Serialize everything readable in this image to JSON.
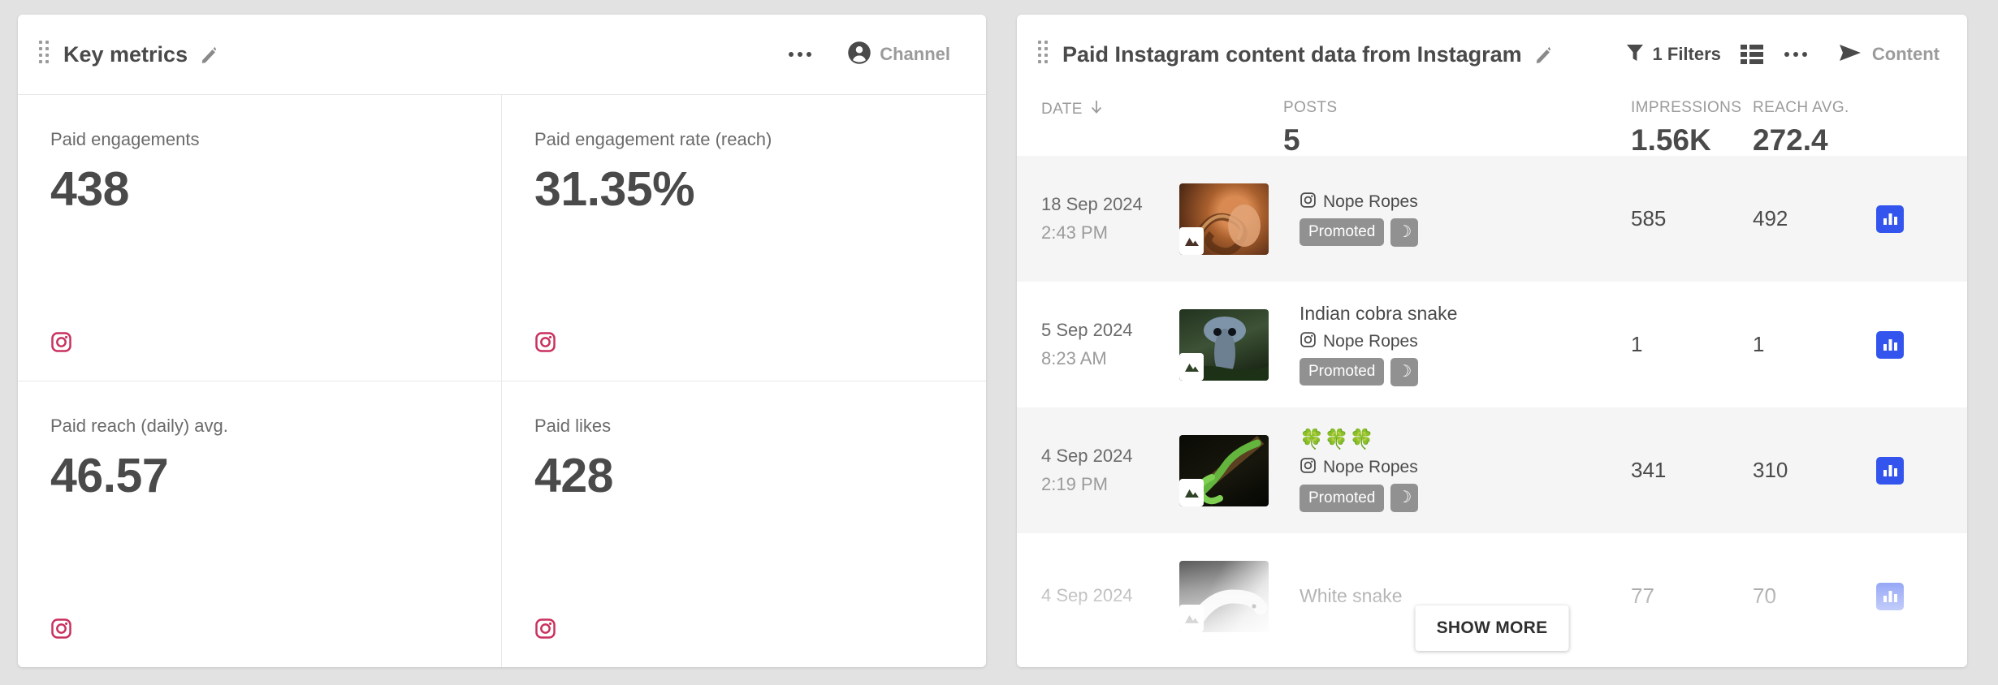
{
  "widgets": {
    "key_metrics": {
      "title": "Key metrics",
      "edit_icon": "pencil-icon",
      "more_icon": "ellipsis-icon",
      "channel_label": "Channel",
      "channel_icon": "person-icon",
      "drag_icon": "drag-handle-icon",
      "metrics": [
        {
          "label": "Paid engagements",
          "value": "438",
          "network_icon": "instagram-icon"
        },
        {
          "label": "Paid engagement rate (reach)",
          "value": "31.35%",
          "network_icon": "instagram-icon"
        },
        {
          "label": "Paid reach (daily) avg.",
          "value": "46.57",
          "network_icon": "instagram-icon"
        },
        {
          "label": "Paid likes",
          "value": "428",
          "network_icon": "instagram-icon"
        }
      ]
    },
    "content_table": {
      "title": "Paid Instagram content data from Instagram",
      "edit_icon": "pencil-icon",
      "drag_icon": "drag-handle-icon",
      "filters_label": "1 Filters",
      "filters_icon": "funnel-icon",
      "list_view_icon": "list-view-icon",
      "more_icon": "ellipsis-icon",
      "content_label": "Content",
      "content_icon": "send-icon",
      "show_more_label": "SHOW MORE",
      "columns": [
        {
          "key": "date",
          "label": "DATE",
          "sort_icon": "arrow-down-icon",
          "summary": ""
        },
        {
          "key": "posts",
          "label": "POSTS",
          "summary": "5"
        },
        {
          "key": "impressions",
          "label": "IMPRESSIONS",
          "summary": "1.56K"
        },
        {
          "key": "reach_avg",
          "label": "REACH AVG.",
          "summary": "272.4"
        }
      ],
      "rows": [
        {
          "date": "18 Sep 2024",
          "time": "2:43 PM",
          "thumbnail_icon": "photo-icon",
          "thumbnail_colors": [
            "#8c4a2a",
            "#c8763f",
            "#3b2216"
          ],
          "caption": "",
          "account": "Nope Ropes",
          "account_icon": "instagram-outline-icon",
          "tags": [
            "Promoted",
            "☽"
          ],
          "impressions": "585",
          "reach_avg": "492",
          "action_icon": "bar-chart-icon"
        },
        {
          "date": "5 Sep 2024",
          "time": "8:23 AM",
          "thumbnail_icon": "photo-icon",
          "thumbnail_colors": [
            "#2d4232",
            "#6f8d6b",
            "#15200f"
          ],
          "caption": "Indian cobra snake",
          "account": "Nope Ropes",
          "account_icon": "instagram-outline-icon",
          "tags": [
            "Promoted",
            "☽"
          ],
          "impressions": "1",
          "reach_avg": "1",
          "action_icon": "bar-chart-icon"
        },
        {
          "date": "4 Sep 2024",
          "time": "2:19 PM",
          "thumbnail_icon": "photo-icon",
          "thumbnail_colors": [
            "#0d0d08",
            "#5fae3a",
            "#2a1c0d"
          ],
          "caption": "🍀🍀🍀",
          "account": "Nope Ropes",
          "account_icon": "instagram-outline-icon",
          "tags": [
            "Promoted",
            "☽"
          ],
          "impressions": "341",
          "reach_avg": "310",
          "action_icon": "bar-chart-icon"
        },
        {
          "date": "4 Sep 2024",
          "time": "",
          "thumbnail_icon": "photo-icon",
          "thumbnail_colors": [
            "#2b2b2b",
            "#e8e8e8",
            "#7d7d7d"
          ],
          "caption": "White snake",
          "account": "",
          "account_icon": "instagram-outline-icon",
          "tags": [],
          "impressions": "77",
          "reach_avg": "70",
          "action_icon": "bar-chart-icon"
        }
      ]
    }
  },
  "colors": {
    "instagram": "#c9315e",
    "accent_blue": "#3355ee",
    "chip_gray": "#919191",
    "text_dark": "#4a4a4a",
    "text_muted": "#9b9b9b",
    "row_alt": "#f5f5f5",
    "page_bg": "#e2e2e2"
  }
}
